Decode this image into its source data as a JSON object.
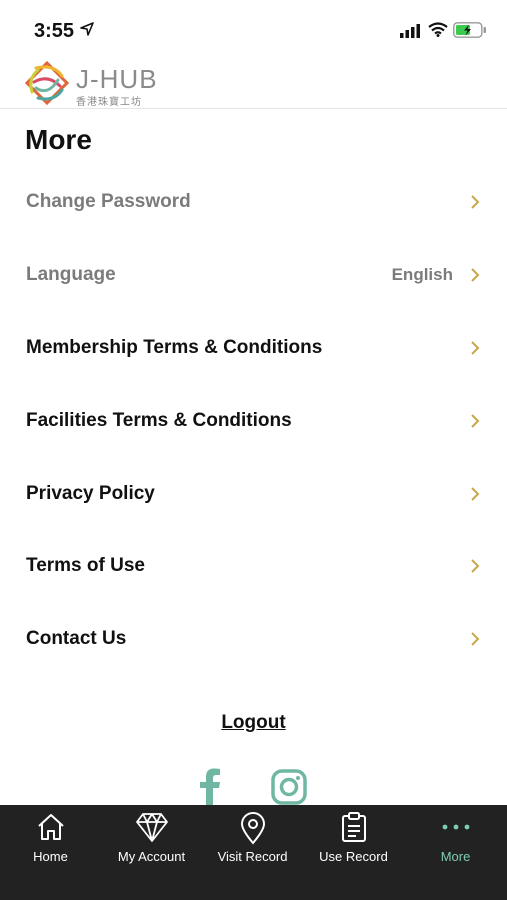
{
  "status_bar": {
    "time": "3:55"
  },
  "header": {
    "brand": "J-HUB",
    "brand_sub": "香港珠寶工坊"
  },
  "page": {
    "title": "More"
  },
  "menu": [
    {
      "label": "Change Password",
      "value": ""
    },
    {
      "label": "Language",
      "value": "English"
    },
    {
      "label": "Membership Terms & Conditions",
      "value": ""
    },
    {
      "label": "Facilities Terms & Conditions",
      "value": ""
    },
    {
      "label": "Privacy Policy",
      "value": ""
    },
    {
      "label": "Terms of Use",
      "value": ""
    },
    {
      "label": "Contact Us",
      "value": ""
    }
  ],
  "logout_label": "Logout",
  "social": [
    "facebook-icon",
    "instagram-icon"
  ],
  "tabs": [
    {
      "label": "Home",
      "icon": "home-icon"
    },
    {
      "label": "My Account",
      "icon": "diamond-icon"
    },
    {
      "label": "Visit Record",
      "icon": "location-pin-icon"
    },
    {
      "label": "Use Record",
      "icon": "clipboard-icon"
    },
    {
      "label": "More",
      "icon": "more-dots-icon"
    }
  ],
  "colors": {
    "accent": "#c6a84a",
    "tab_active": "#7fcdb0",
    "tabbar_bg": "#222222",
    "social": "#6fb7a3"
  }
}
